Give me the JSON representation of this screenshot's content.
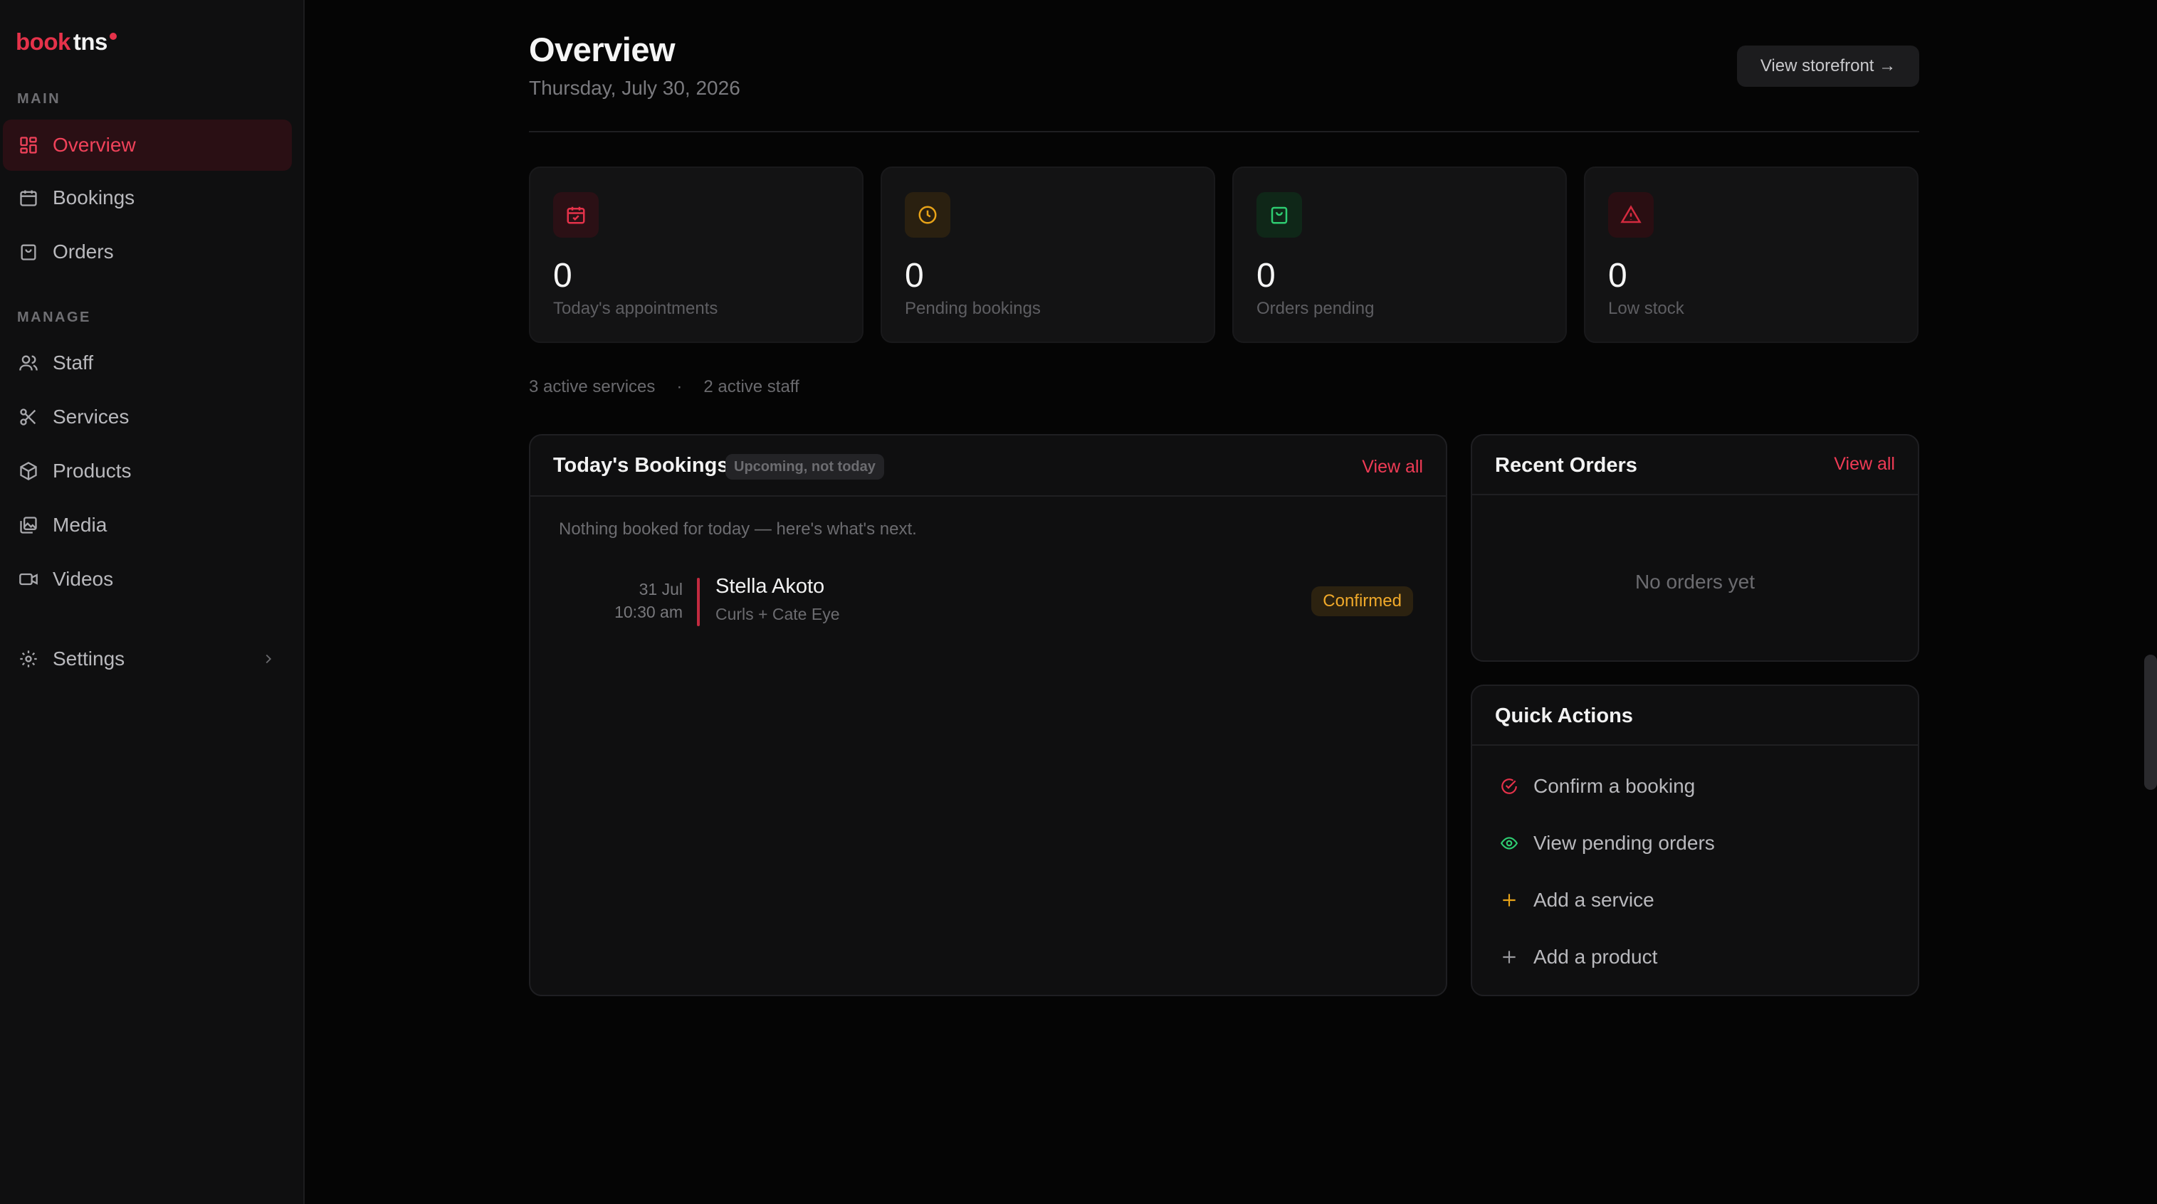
{
  "brand": {
    "part1": "book",
    "part2": "tns"
  },
  "sidebar": {
    "main_label": "MAIN",
    "manage_label": "MANAGE",
    "items": [
      {
        "label": "Overview"
      },
      {
        "label": "Bookings"
      },
      {
        "label": "Orders"
      },
      {
        "label": "Staff"
      },
      {
        "label": "Services"
      },
      {
        "label": "Products"
      },
      {
        "label": "Media"
      },
      {
        "label": "Videos"
      },
      {
        "label": "Settings"
      }
    ]
  },
  "header": {
    "title": "Overview",
    "date": "Thursday, July 30, 2026",
    "storefront_button": "View storefront →"
  },
  "stats": [
    {
      "value": "0",
      "label": "Today's appointments",
      "icon": "calendar-check-icon",
      "color": "#e5324a"
    },
    {
      "value": "0",
      "label": "Pending bookings",
      "icon": "clock-icon",
      "color": "#e8a318"
    },
    {
      "value": "0",
      "label": "Orders pending",
      "icon": "shopping-bag-icon",
      "color": "#2ecc71"
    },
    {
      "value": "0",
      "label": "Low stock",
      "icon": "alert-triangle-icon",
      "color": "#d42a3f"
    }
  ],
  "meta": {
    "services": "3 active services",
    "separator": "·",
    "staff": "2 active staff"
  },
  "bookings_panel": {
    "title": "Today's Bookings",
    "pill": "Upcoming, not today",
    "view_all": "View all",
    "note": "Nothing booked for today — here's what's next.",
    "rows": [
      {
        "day": "31 Jul",
        "time": "10:30 am",
        "name": "Stella Akoto",
        "service": "Curls + Cate Eye",
        "status": "Confirmed"
      }
    ]
  },
  "orders_panel": {
    "title": "Recent Orders",
    "view_all": "View all",
    "empty": "No orders yet"
  },
  "quick_actions": {
    "title": "Quick Actions",
    "items": [
      {
        "label": "Confirm a booking",
        "icon": "check-circle-icon",
        "color": "#e5324a"
      },
      {
        "label": "View pending orders",
        "icon": "eye-icon",
        "color": "#2ecc71"
      },
      {
        "label": "Add a service",
        "icon": "plus-icon",
        "color": "#e8a318"
      },
      {
        "label": "Add a product",
        "icon": "plus-icon",
        "color": "#9a9a9e"
      }
    ]
  },
  "colors": {
    "accent": "#e5324a",
    "background": "#050505",
    "sidebar": "#0f0f10",
    "card": "#131314"
  }
}
